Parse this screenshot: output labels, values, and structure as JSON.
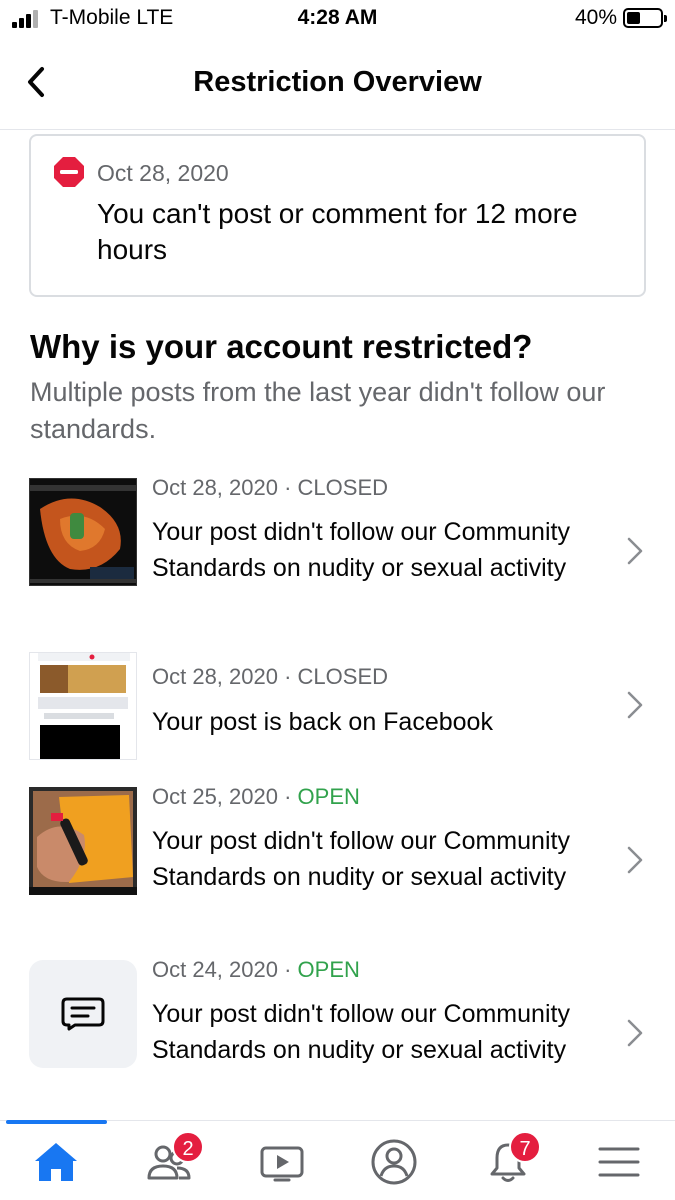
{
  "status_bar": {
    "carrier": "T-Mobile  LTE",
    "time": "4:28 AM",
    "battery": "40%",
    "battery_level": 0.4
  },
  "header": {
    "title": "Restriction Overview",
    "back_icon": "chevron-left-icon"
  },
  "restriction": {
    "icon": "no-entry-icon",
    "date": "Oct 28, 2020",
    "message": "You can't post or comment for 12 more hours"
  },
  "section": {
    "heading": "Why is your account restricted?",
    "subtitle": "Multiple posts from the last year didn't follow our standards."
  },
  "violations": [
    {
      "date": "Oct 28, 2020",
      "separator": " · ",
      "status": "CLOSED",
      "text": "Your post didn't follow our Community Standards on nudity or sexual activity",
      "thumb": "photo"
    },
    {
      "date": "Oct 28, 2020",
      "separator": " · ",
      "status": "CLOSED",
      "text": "Your post is back on Facebook",
      "thumb": "screenshot"
    },
    {
      "date": "Oct 25, 2020",
      "separator": " · ",
      "status": "OPEN",
      "text": "Your post didn't follow our Community Standards on nudity or sexual activity",
      "thumb": "photo"
    },
    {
      "date": "Oct 24, 2020",
      "separator": " · ",
      "status": "OPEN",
      "text": "Your post didn't follow our Community Standards on nudity or sexual activity",
      "thumb": "text-post-icon"
    }
  ],
  "tab_bar": {
    "tabs": [
      {
        "name": "home-icon",
        "active": true
      },
      {
        "name": "friends-icon",
        "badge": "2"
      },
      {
        "name": "watch-icon"
      },
      {
        "name": "profile-icon"
      },
      {
        "name": "notifications-icon",
        "badge": "7"
      },
      {
        "name": "menu-icon"
      }
    ]
  },
  "colors": {
    "accent": "#1877f2",
    "open": "#31a24c",
    "closed": "#65676b",
    "badge": "#e41e3f",
    "no_entry": "#e41e3f"
  }
}
